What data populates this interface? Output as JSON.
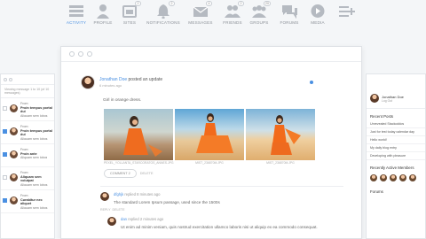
{
  "nav": [
    {
      "label": "ACTIVITY",
      "icon": "activity-icon",
      "badge": ""
    },
    {
      "label": "PROFILE",
      "icon": "profile-icon",
      "badge": ""
    },
    {
      "label": "SITES",
      "icon": "sites-icon",
      "badge": "2"
    },
    {
      "label": "NOTIFICATIONS",
      "icon": "bell-icon",
      "badge": "2"
    },
    {
      "label": "MESSAGES",
      "icon": "envelope-icon",
      "badge": "4"
    },
    {
      "label": "FRIENDS",
      "icon": "friends-icon",
      "badge": "2"
    },
    {
      "label": "GROUPS",
      "icon": "groups-icon",
      "badge": "20"
    },
    {
      "label": "FORUMS",
      "icon": "forums-icon",
      "badge": ""
    },
    {
      "label": "MEDIA",
      "icon": "media-icon",
      "badge": ""
    },
    {
      "label": "",
      "icon": "more-icon",
      "badge": ""
    }
  ],
  "left": {
    "summary": "Viewing message 1 to 10 (of 10 messages)",
    "messages": [
      {
        "from": "From: ",
        "subject": "Proin tempus portal dui",
        "body": "Aliquam sem lobos",
        "checked": false
      },
      {
        "from": "From: ",
        "subject": "Proin tempus portal dui",
        "body": "Aliquam sem lobos",
        "checked": true
      },
      {
        "from": "From: ",
        "subject": "Proin ante",
        "body": "Aliquam sem lobos",
        "checked": true
      },
      {
        "from": "From: ",
        "subject": "Aliquam sem volutpat",
        "body": "Aliquam sem lobos",
        "checked": false
      },
      {
        "from": "From: ",
        "subject": "Curabitur nec aliquet",
        "body": "Aliquam sem lobos",
        "checked": true
      }
    ]
  },
  "post": {
    "author": "Jonathan Doe",
    "action": "posted an update",
    "time": "6 minutes ago",
    "text": "Girl in orange dress.",
    "captions": [
      "PEXEL_YOLLANTA_STARCORATOS_ANNES.JPG",
      "MIST_236870M.JPG",
      "MIST_236870M.JPG"
    ],
    "comment_button": "COMMENT",
    "comment_count": "2",
    "delete": "DELETE"
  },
  "comments": [
    {
      "author": "dfghjk",
      "action": "replied",
      "time": "8 minutes ago",
      "text": "The standard Lorem Ipsum passage, used since the 1500s",
      "reply": "REPLY",
      "delete": "DELETE"
    },
    {
      "author": "dan",
      "action": "replied",
      "time": "2 minutes ago",
      "text": "Ut enim ad minim veniam, quis nostrud exercitation ullamco laboris nisi ut aliquip ex ea commodo consequat."
    }
  ],
  "right": {
    "user_name": "Jonathan Doe",
    "user_link": "Log Out",
    "recent_title": "Recent Posts",
    "recent": [
      "Unrevealed Stackoddos",
      "Just for test today calendar day",
      "Hello world!",
      "My daily blog entry",
      "Developing with pleasure"
    ],
    "members_title": "Recently Active Members",
    "forums_title": "Forums"
  },
  "colors": {
    "accent": "#4a90e2"
  }
}
